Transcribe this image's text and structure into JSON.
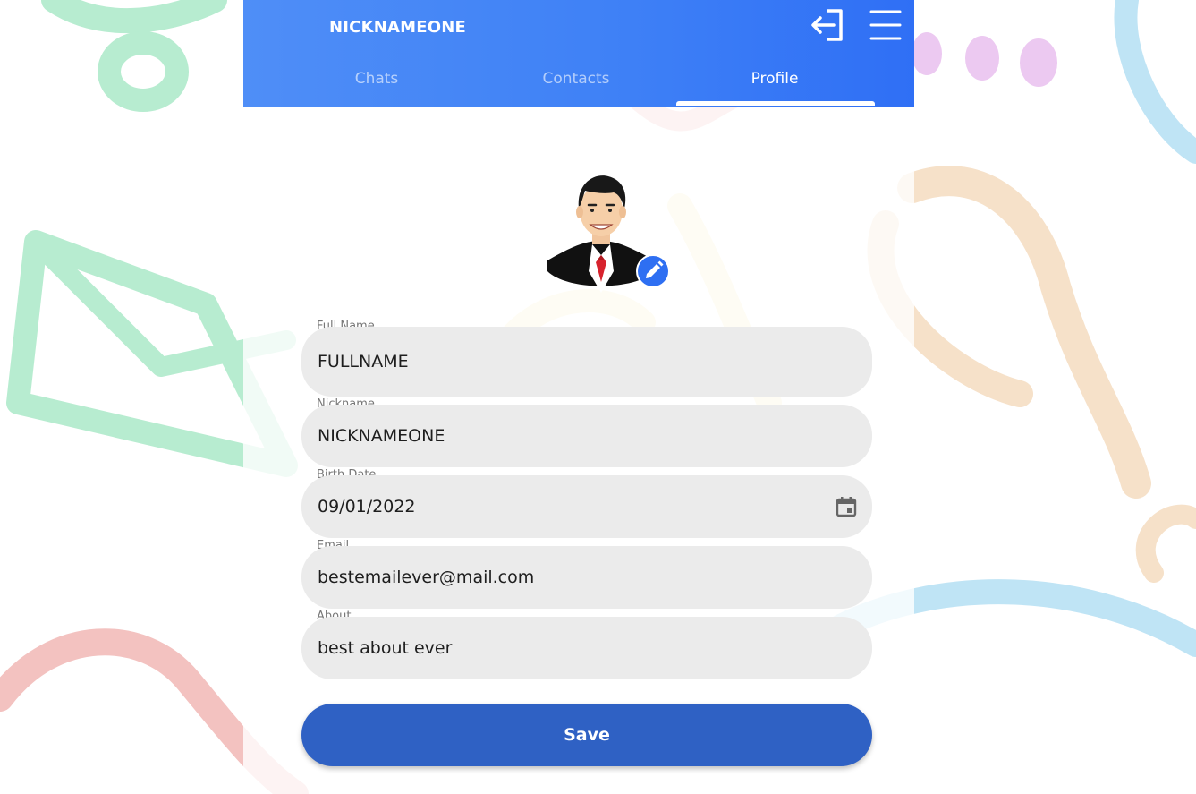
{
  "header": {
    "title": "NICKNAMEONE",
    "logout_icon": "logout-icon",
    "menu_icon": "hamburger-menu-icon",
    "tabs": [
      {
        "label": "Chats"
      },
      {
        "label": "Contacts"
      },
      {
        "label": "Profile",
        "active": true
      }
    ]
  },
  "profile": {
    "avatar": "avatar-businessman",
    "edit_icon": "pencil-icon",
    "fields": {
      "full_name": {
        "label": "Full Name",
        "value": "FULLNAME"
      },
      "nickname": {
        "label": "Nickname",
        "value": "NICKNAMEONE"
      },
      "birth_date": {
        "label": "Birth Date",
        "value": "09/01/2022",
        "icon": "calendar-icon"
      },
      "email": {
        "label": "Email",
        "value": "bestemailever@mail.com"
      },
      "about": {
        "label": "About",
        "value": "best about ever"
      }
    },
    "save_label": "Save"
  },
  "colors": {
    "header_blue": "#3f81f6",
    "save_blue": "#2f61c4",
    "field_bg": "#ebebeb"
  }
}
